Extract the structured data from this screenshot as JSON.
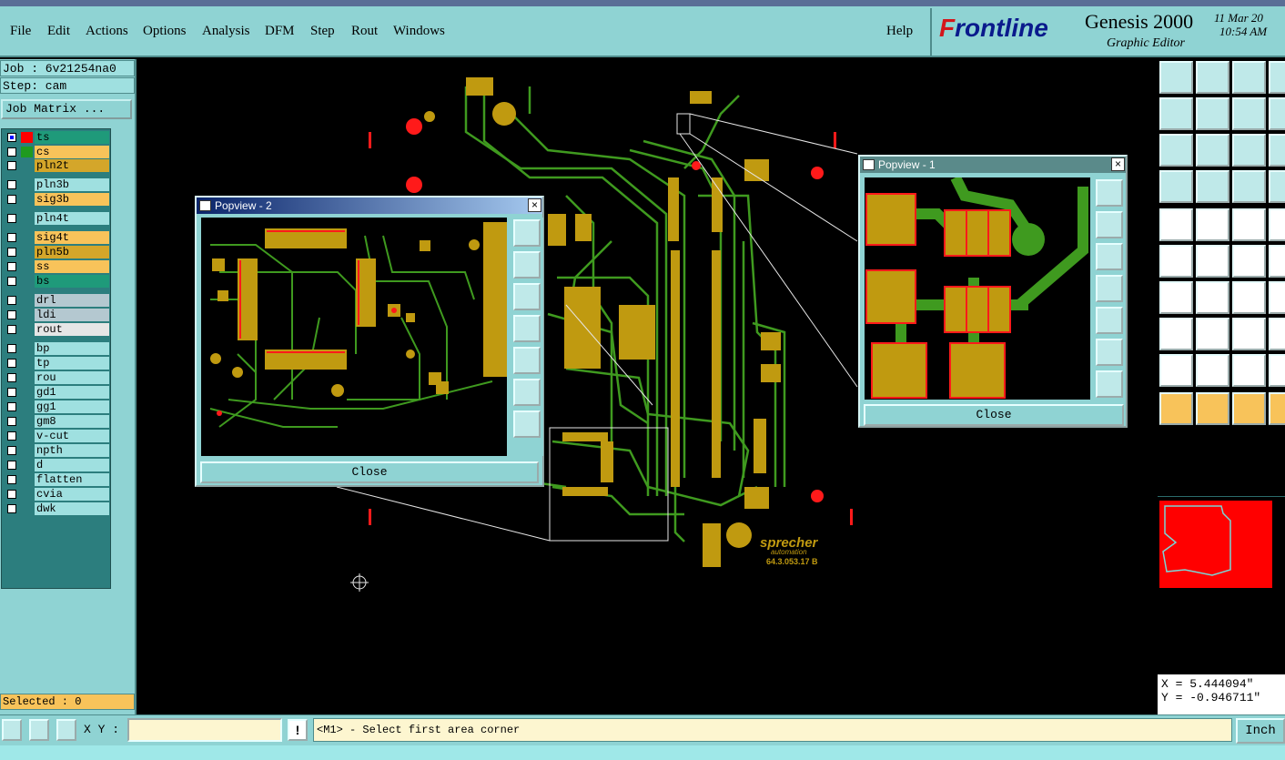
{
  "menubar": {
    "items": [
      "File",
      "Edit",
      "Actions",
      "Options",
      "Analysis",
      "DFM",
      "Step",
      "Rout",
      "Windows"
    ],
    "help": "Help"
  },
  "brand": {
    "logo_red": "F",
    "logo_blue": "rontline",
    "product": "Genesis 2000",
    "subtitle": "Graphic Editor",
    "date": "11 Mar 20",
    "time": "10:54 AM"
  },
  "left_panel": {
    "job": "Job : 6v21254na0",
    "step": "Step: cam",
    "job_matrix_button": "Job Matrix ...",
    "layers": [
      {
        "name": "ts",
        "color": "#1f9a7a",
        "swatch": "#ff0000",
        "checked": true
      },
      {
        "name": "cs",
        "color": "#f8c35a",
        "swatch": "#1f9a1f",
        "checked": false
      },
      {
        "name": "pln2t",
        "color": "#d4a62a",
        "swatch": "",
        "checked": false
      },
      {
        "name": "pln3b",
        "color": "#9fe0e0",
        "swatch": "",
        "checked": false
      },
      {
        "name": "sig3b",
        "color": "#f8c35a",
        "swatch": "",
        "checked": false
      },
      {
        "name": "pln4t",
        "color": "#9fe0e0",
        "swatch": "",
        "checked": false
      },
      {
        "name": "sig4t",
        "color": "#f8c35a",
        "swatch": "",
        "checked": false
      },
      {
        "name": "pln5b",
        "color": "#d4a62a",
        "swatch": "",
        "checked": false
      },
      {
        "name": "ss",
        "color": "#f8c35a",
        "swatch": "",
        "checked": false
      },
      {
        "name": "bs",
        "color": "#1f9a7a",
        "swatch": "",
        "checked": false
      },
      {
        "name": "drl",
        "color": "#b4c8d0",
        "swatch": "",
        "checked": false
      },
      {
        "name": "ldi",
        "color": "#b4c8d0",
        "swatch": "",
        "checked": false
      },
      {
        "name": "rout",
        "color": "#e6e6e6",
        "swatch": "",
        "checked": false
      },
      {
        "name": "bp",
        "color": "#9fe0e0",
        "swatch": "",
        "checked": false
      },
      {
        "name": "tp",
        "color": "#9fe0e0",
        "swatch": "",
        "checked": false
      },
      {
        "name": "rou",
        "color": "#9fe0e0",
        "swatch": "",
        "checked": false
      },
      {
        "name": "gd1",
        "color": "#9fe0e0",
        "swatch": "",
        "checked": false
      },
      {
        "name": "gg1",
        "color": "#9fe0e0",
        "swatch": "",
        "checked": false
      },
      {
        "name": "gm8",
        "color": "#9fe0e0",
        "swatch": "",
        "checked": false
      },
      {
        "name": "v-cut",
        "color": "#9fe0e0",
        "swatch": "",
        "checked": false
      },
      {
        "name": "npth",
        "color": "#9fe0e0",
        "swatch": "",
        "checked": false
      },
      {
        "name": "d",
        "color": "#9fe0e0",
        "swatch": "",
        "checked": false
      },
      {
        "name": "flatten",
        "color": "#9fe0e0",
        "swatch": "",
        "checked": false
      },
      {
        "name": "cvia",
        "color": "#9fe0e0",
        "swatch": "",
        "checked": false
      },
      {
        "name": "dwk",
        "color": "#9fe0e0",
        "swatch": "",
        "checked": false
      }
    ],
    "selected": "Selected : 0"
  },
  "popview1": {
    "title": "Popview - 1",
    "close": "Close"
  },
  "popview2": {
    "title": "Popview - 2",
    "close": "Close"
  },
  "board": {
    "logo_text": "sprecher",
    "logo_sub": "automation",
    "part_no": "64.3.053.17 B"
  },
  "coords": {
    "x": "X =  5.444094\"",
    "y": "Y = -0.946711\""
  },
  "bottom": {
    "xy_label": "X Y :",
    "xy_value": "",
    "alert": "!",
    "prompt": "<M1> - Select first area corner",
    "units": "Inch"
  },
  "colors": {
    "panel": "#8fd3d3",
    "copper": "#c09a10",
    "trace": "#3f9a1f",
    "pad_red": "#ff1a1a"
  }
}
